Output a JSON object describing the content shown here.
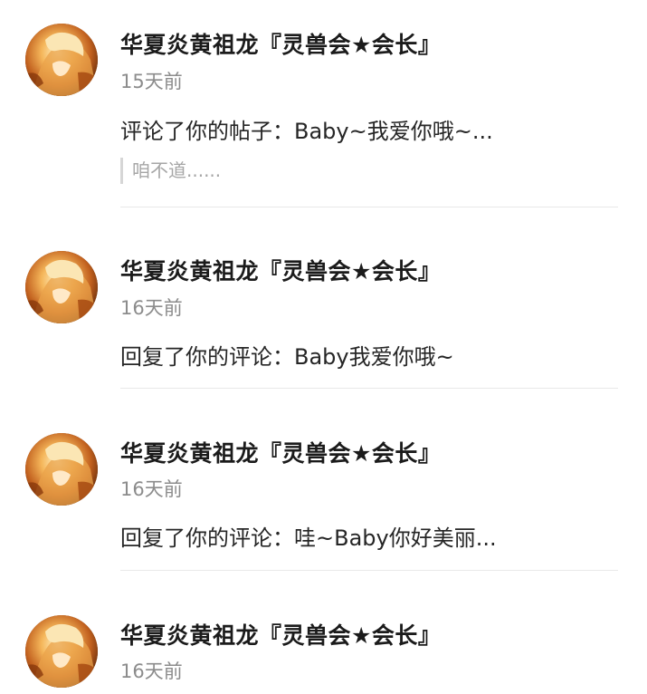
{
  "notifications": [
    {
      "user_name": "华夏炎黄祖龙『灵兽会★会长』",
      "time": "15天前",
      "action_text": "评论了你的帖子：Baby~我爱你哦~...",
      "quote_text": "咱不道......",
      "avatar_icon": "anime-character-avatar"
    },
    {
      "user_name": "华夏炎黄祖龙『灵兽会★会长』",
      "time": "16天前",
      "action_text": "回复了你的评论：Baby我爱你哦~",
      "avatar_icon": "anime-character-avatar"
    },
    {
      "user_name": "华夏炎黄祖龙『灵兽会★会长』",
      "time": "16天前",
      "action_text": "回复了你的评论：哇~Baby你好美丽...",
      "avatar_icon": "anime-character-avatar"
    },
    {
      "user_name": "华夏炎黄祖龙『灵兽会★会长』",
      "time": "16天前",
      "avatar_icon": "anime-character-avatar"
    }
  ],
  "colors": {
    "name": "#1b1b1b",
    "time": "#8c8c8c",
    "quote": "#a6a6a6",
    "divider": "#e9e9e9"
  }
}
